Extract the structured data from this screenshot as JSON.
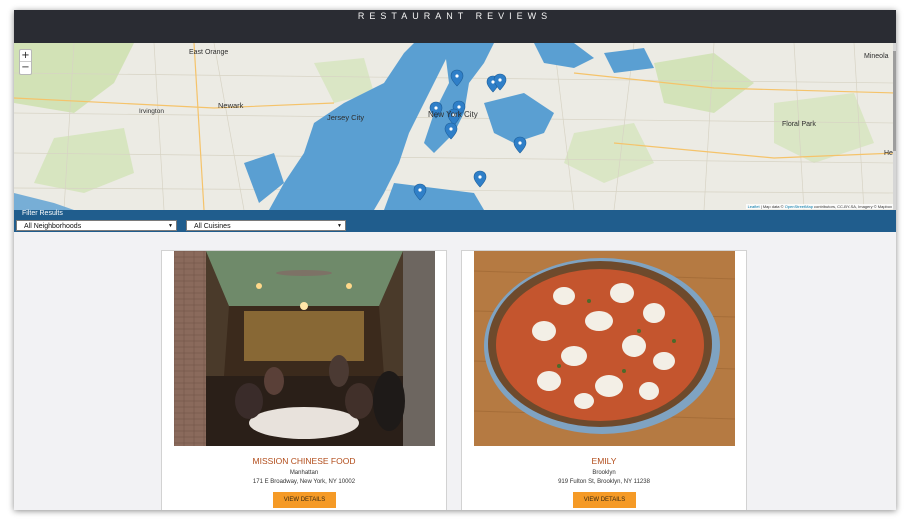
{
  "header": {
    "title": "RESTAURANT REVIEWS"
  },
  "map": {
    "zoom_in": "+",
    "zoom_out": "−",
    "labels": [
      "East Orange",
      "Newark",
      "Irvington",
      "Jersey City",
      "New York City",
      "Floral Park",
      "Mineola",
      "He"
    ],
    "attribution": {
      "leaflet": "Leaflet",
      "text": " | Map data © ",
      "osm": "OpenStreetMap",
      "rest": " contributors, CC-BY-SA, Imagery © Mapbox"
    },
    "colors": {
      "water": "#5a9fd2",
      "land": "#ecebe4",
      "park": "#c9dfa7",
      "marker": "#2f7fc8"
    }
  },
  "filter": {
    "label": "Filter Results",
    "neighborhoods_selected": "All Neighborhoods",
    "cuisines_selected": "All Cuisines"
  },
  "restaurants": [
    {
      "name": "MISSION CHINESE FOOD",
      "neighborhood": "Manhattan",
      "address": "171 E Broadway, New York, NY 10002",
      "button": "VIEW DETAILS"
    },
    {
      "name": "EMILY",
      "neighborhood": "Brooklyn",
      "address": "919 Fulton St, Brooklyn, NY 11238",
      "button": "VIEW DETAILS"
    }
  ],
  "theme": {
    "header_bg": "#2a2c33",
    "filter_bg": "#205d8d",
    "accent": "#f59a26",
    "title_color": "#b24d1b"
  }
}
